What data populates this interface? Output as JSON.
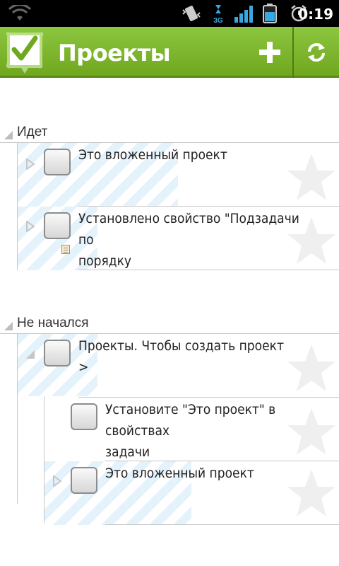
{
  "status_bar": {
    "time": "0:19",
    "network_label": "3G"
  },
  "action_bar": {
    "title": "Проекты",
    "add_icon": "plus-icon",
    "sync_icon": "sync-icon"
  },
  "sections": [
    {
      "title": "Идет",
      "items": [
        {
          "text_lines": [
            "Это вложенный проект"
          ]
        },
        {
          "text_lines": [
            "Установлено свойство \"Подзадачи по",
            "порядку"
          ]
        }
      ]
    },
    {
      "title": "Не начался",
      "items": [
        {
          "text_lines": [
            "Проекты. Чтобы создать проект >"
          ]
        },
        {
          "text_lines": [
            "Установите \"Это проект\" в свойствах",
            "задачи"
          ]
        },
        {
          "text_lines": [
            "Это вложенный проект"
          ]
        }
      ]
    }
  ]
}
